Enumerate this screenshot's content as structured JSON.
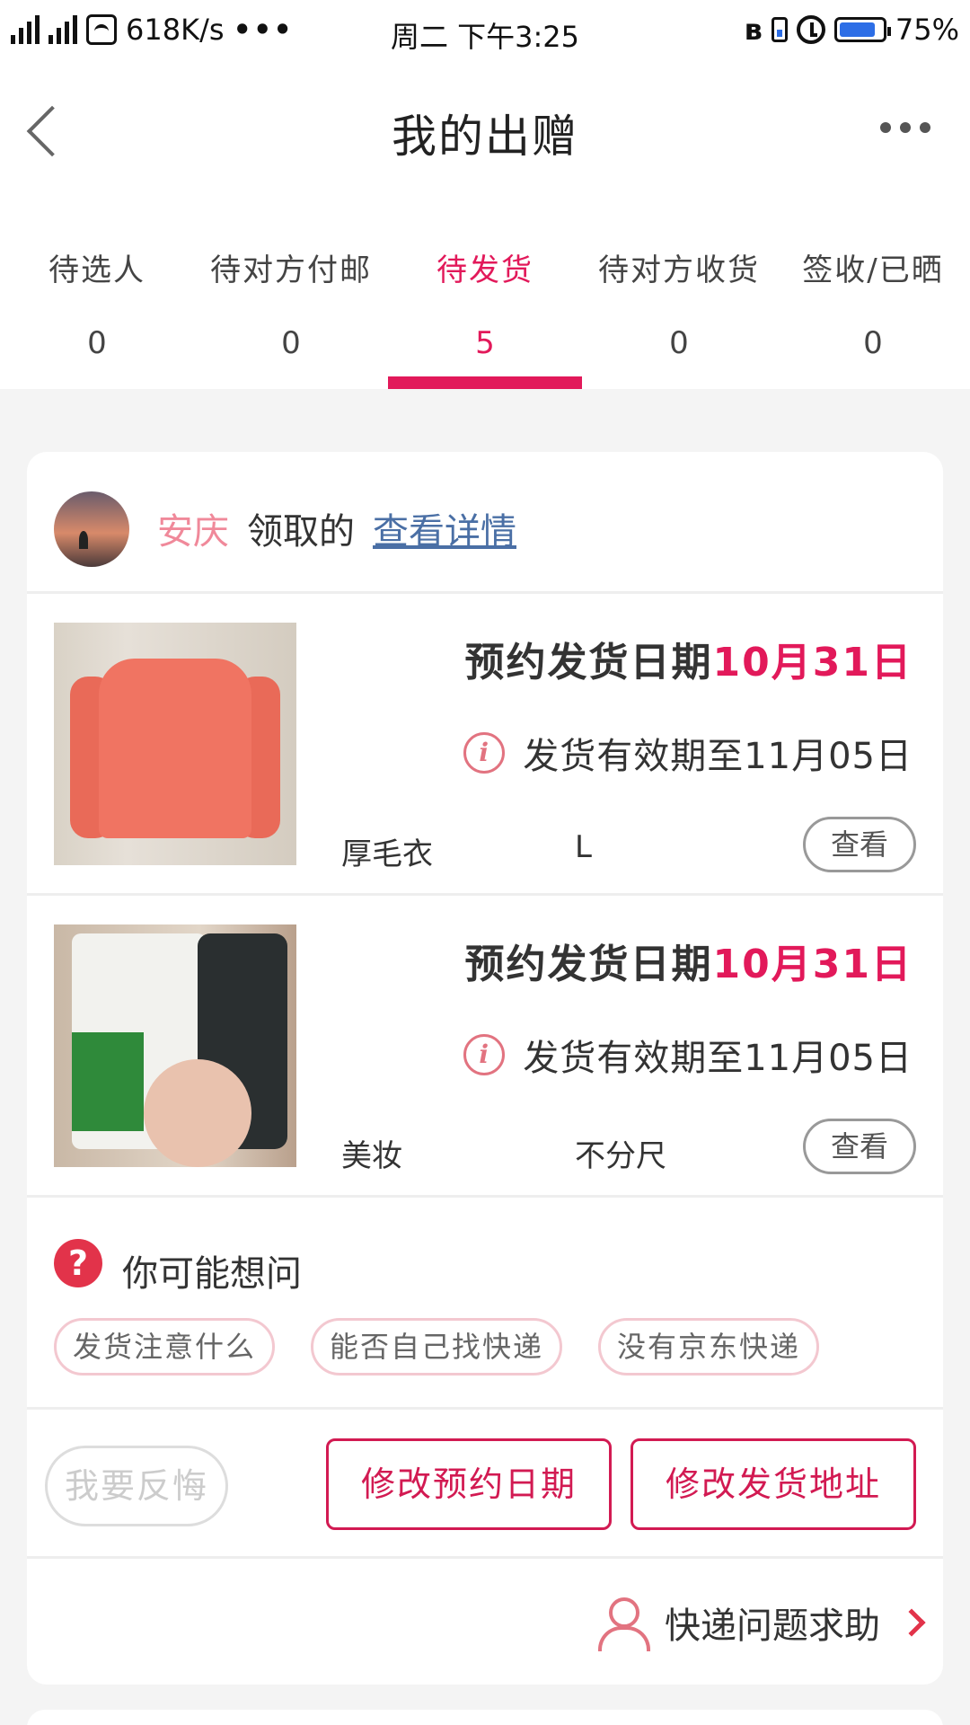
{
  "status_bar": {
    "network_speed": "618K/s",
    "more": "•••",
    "datetime": "周二 下午3:25",
    "battery_percent": "75%",
    "battery_level": 0.75,
    "icons": [
      "hd-signal-icon",
      "signal-icon",
      "wifi-icon",
      "bluetooth-icon",
      "battery-small-icon",
      "alarm-icon",
      "battery-icon"
    ]
  },
  "nav": {
    "title": "我的出赠",
    "icons": [
      "back-icon",
      "more-icon"
    ]
  },
  "tabs": [
    {
      "label": "待选人",
      "count": "0"
    },
    {
      "label": "待对方付邮",
      "count": "0"
    },
    {
      "label": "待发货",
      "count": "5",
      "active": true
    },
    {
      "label": "待对方收货",
      "count": "0"
    },
    {
      "label": "签收/已晒",
      "count": "0"
    }
  ],
  "order": {
    "recipient_city": "安庆",
    "claim_text": "领取的",
    "detail_link": "查看详情",
    "items": [
      {
        "schedule_label": "预约发货日期",
        "schedule_date": "10月31日",
        "validity": "发货有效期至11月05日",
        "name": "厚毛衣",
        "size": "L",
        "view_label": "查看"
      },
      {
        "schedule_label": "预约发货日期",
        "schedule_date": "10月31日",
        "validity": "发货有效期至11月05日",
        "name": "美妆",
        "size": "不分尺",
        "view_label": "查看"
      }
    ],
    "faq": {
      "title": "你可能想问",
      "chips": [
        "发货注意什么",
        "能否自己找快递",
        "没有京东快递"
      ]
    },
    "actions": {
      "regret": "我要反悔",
      "change_date": "修改预约日期",
      "change_address": "修改发货地址"
    },
    "help": "快递问题求助"
  },
  "colors": {
    "accent": "#e2195a",
    "city": "#f0899a",
    "link": "#4a6fa5"
  }
}
